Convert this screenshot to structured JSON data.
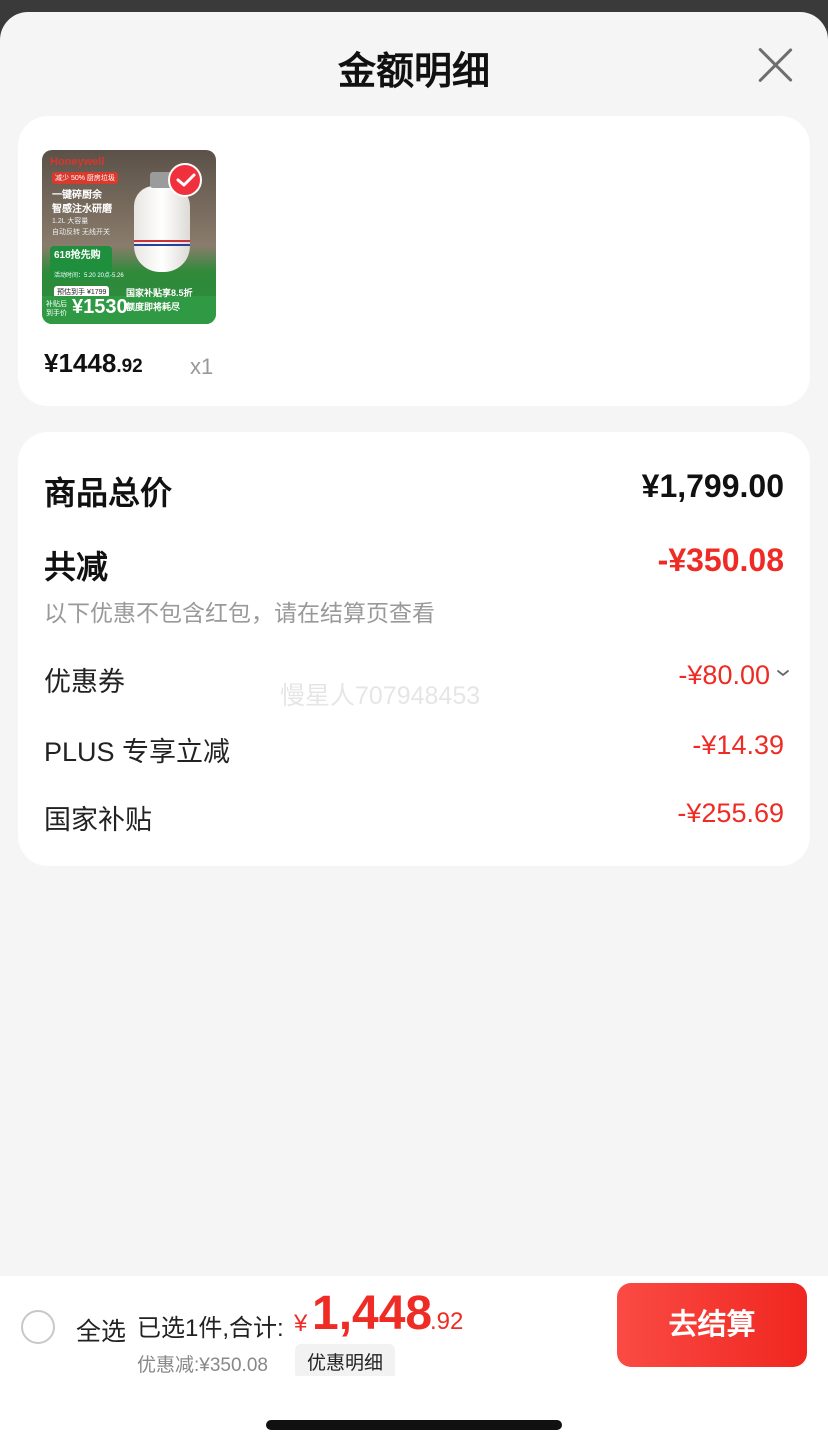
{
  "header": {
    "title": "金额明细"
  },
  "product": {
    "thumbnail": {
      "brand": "Honeywell",
      "tag": "减少 50% 厨房垃圾",
      "line1": "一键碎厨余",
      "line2": "智感注水研磨",
      "line3": "1.2L 大容量",
      "line4": "自动反转 无线开关",
      "promo": "618抢先购",
      "promo_sub": "活动时间：5.20 20点-5.26",
      "presale": "预估到手 ¥1799",
      "final_label": "补贴后\n到手价",
      "final_price": "¥1530",
      "subsidy": "国家补贴享8.5折",
      "limit": "额度即将耗尽"
    },
    "price_int": "¥1448",
    "price_dec": ".92",
    "quantity": "x1",
    "selected": true
  },
  "details": {
    "total_label": "商品总价",
    "total_value": "¥1,799.00",
    "reduce_label": "共减",
    "reduce_value": "-¥350.08",
    "note": "以下优惠不包含红包，请在结算页查看",
    "items": [
      {
        "label": "优惠券",
        "value": "-¥80.00",
        "expandable": true
      },
      {
        "label": "PLUS 专享立减",
        "value": "-¥14.39"
      },
      {
        "label": "国家补贴",
        "value": "-¥255.69"
      }
    ],
    "watermark": "慢星人707948453"
  },
  "footer": {
    "select_all": "全选",
    "selected_count": "已选1件,合计:",
    "currency": "¥",
    "total_int": "1,448",
    "total_dec": ".92",
    "saved": "优惠减:¥350.08",
    "details_link": "优惠明细",
    "checkout": "去结算"
  },
  "colors": {
    "accent": "#ee2b24",
    "button": "#f02620",
    "background": "#f5f5f5"
  }
}
